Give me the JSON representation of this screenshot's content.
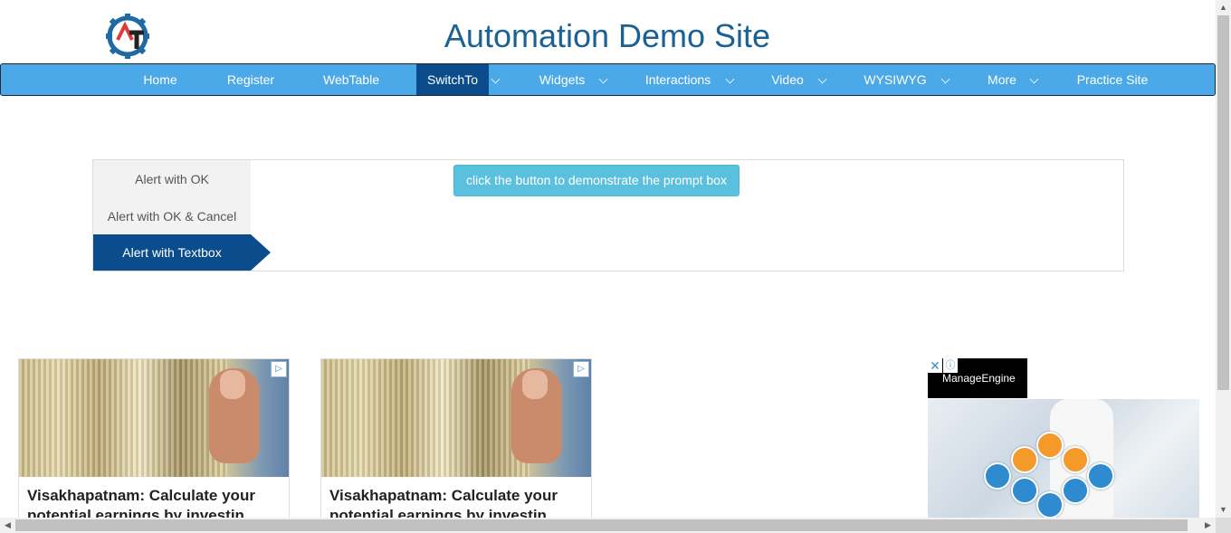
{
  "site": {
    "title": "Automation Demo Site"
  },
  "nav": {
    "items": [
      {
        "label": "Home"
      },
      {
        "label": "Register"
      },
      {
        "label": "WebTable"
      },
      {
        "label": "SwitchTo"
      },
      {
        "label": "Widgets"
      },
      {
        "label": "Interactions"
      },
      {
        "label": "Video"
      },
      {
        "label": "WYSIWYG"
      },
      {
        "label": "More"
      },
      {
        "label": "Practice Site"
      }
    ],
    "active": "SwitchTo",
    "colors": {
      "bar": "#4ca9e8",
      "active": "#0b4d8c"
    }
  },
  "tabs": {
    "items": [
      {
        "label": "Alert with OK"
      },
      {
        "label": "Alert with OK & Cancel"
      },
      {
        "label": "Alert with Textbox"
      }
    ],
    "active": "Alert with Textbox"
  },
  "prompt_button": {
    "label": "click the button to demonstrate the prompt box",
    "color": "#5bc0de"
  },
  "ads": {
    "cards": [
      {
        "headline": "Visakhapatnam: Calculate your potential earnings by investin..."
      },
      {
        "headline": "Visakhapatnam: Calculate your potential earnings by investin..."
      }
    ],
    "display_ad": {
      "brand": "ManageEngine"
    }
  },
  "icons": {
    "logo": "gear-logo-icon",
    "caret": "chevron-down-icon",
    "ad_choices": "ad-choices-icon",
    "close": "close-icon",
    "info": "info-icon"
  }
}
